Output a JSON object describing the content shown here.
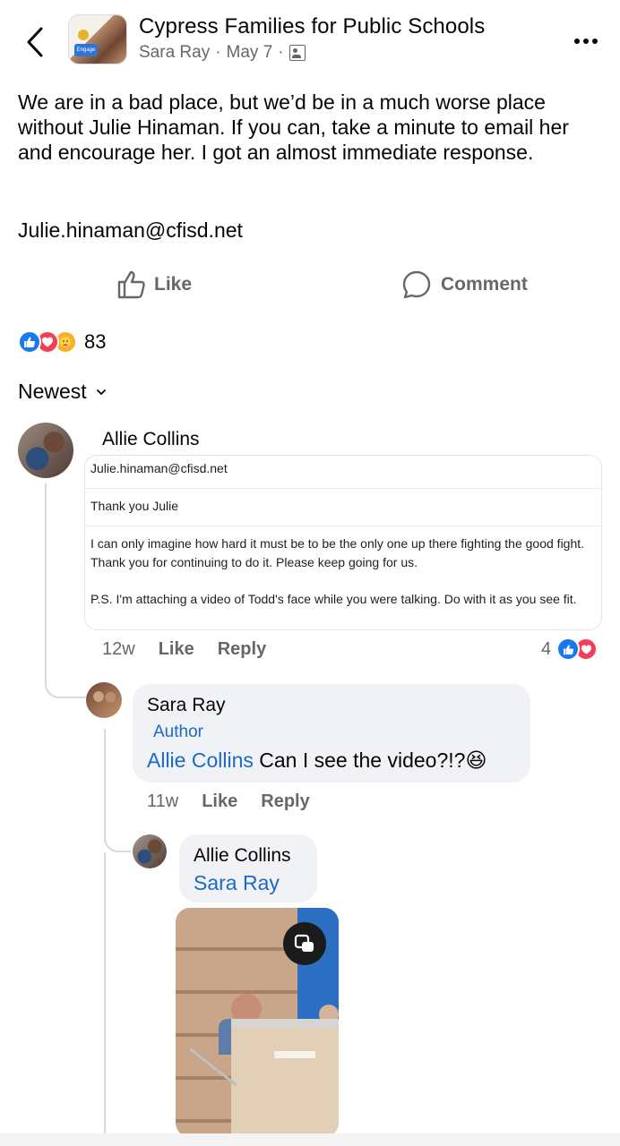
{
  "header": {
    "group_name": "Cypress Families for Public Schools",
    "author": "Sara Ray",
    "separator": "·",
    "date": "May 7",
    "audience_icon": "group-members-icon",
    "avatar_badge_text": "Engage"
  },
  "post": {
    "text": "We are in a bad place, but we’d be in a much worse place without Julie Hinaman. If you can, take a minute to email her and encourage her. I got an almost immediate response.",
    "email": "Julie.hinaman@cfisd.net"
  },
  "actions": {
    "like_label": "Like",
    "comment_label": "Comment"
  },
  "reactions": {
    "icons": [
      "like-reaction-icon",
      "love-reaction-icon",
      "care-reaction-icon"
    ],
    "count": "83"
  },
  "sort": {
    "label": "Newest"
  },
  "comments": [
    {
      "name": "Allie Collins",
      "email_card": {
        "to": "Julie.hinaman@cfisd.net",
        "subject": "Thank you Julie",
        "body_line1": "I can only imagine how hard it must be to be the only one up there fighting the good fight.",
        "body_line2": "Thank you for continuing to do it. Please keep going for us.",
        "ps": "P.S. I'm attaching a video of Todd's face while you were talking. Do with it as you see fit."
      },
      "time": "12w",
      "like_label": "Like",
      "reply_label": "Reply",
      "reaction_count": "4"
    },
    {
      "name": "Sara Ray",
      "badge": "Author",
      "mention": "Allie Collins",
      "text": "Can I see the video?!?",
      "emoji": "😆",
      "time": "11w",
      "like_label": "Like",
      "reply_label": "Reply"
    },
    {
      "name": "Allie Collins",
      "mention": "Sara Ray"
    }
  ],
  "colors": {
    "text": "#050505",
    "secondary": "#65676b",
    "link": "#1b6ac9",
    "like_blue": "#1877f2",
    "love_red": "#f33e58",
    "bubble": "#f0f2f5"
  }
}
